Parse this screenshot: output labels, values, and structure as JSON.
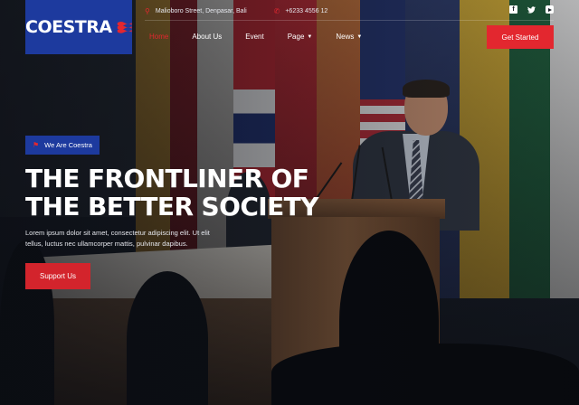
{
  "brand": {
    "name": "COESTRA",
    "logo_bg": "#1d3a9e",
    "accent": "#e3272f"
  },
  "topbar": {
    "address": "Malioboro Street, Denpasar, Bali",
    "address_icon": "map-marker-icon",
    "phone": "+6233 4556 12",
    "phone_icon": "phone-icon",
    "social": [
      "facebook-icon",
      "twitter-icon",
      "youtube-icon"
    ]
  },
  "nav": {
    "items": [
      {
        "label": "Home",
        "active": true
      },
      {
        "label": "About Us"
      },
      {
        "label": "Event"
      },
      {
        "label": "Page",
        "has_dropdown": true
      },
      {
        "label": "News",
        "has_dropdown": true
      }
    ],
    "cta_label": "Get Started"
  },
  "hero": {
    "badge": "We Are Coestra",
    "badge_icon": "flag-icon",
    "headline_line1": "THE FRONTLINER OF",
    "headline_line2": "THE BETTER SOCIETY",
    "subtext_line1": "Lorem ipsum dolor sit amet, consectetur adipiscing elit. Ut elit",
    "subtext_line2": "tellus, luctus nec ullamcorper mattis, pulvinar dapibus.",
    "button_label": "Support Us"
  }
}
